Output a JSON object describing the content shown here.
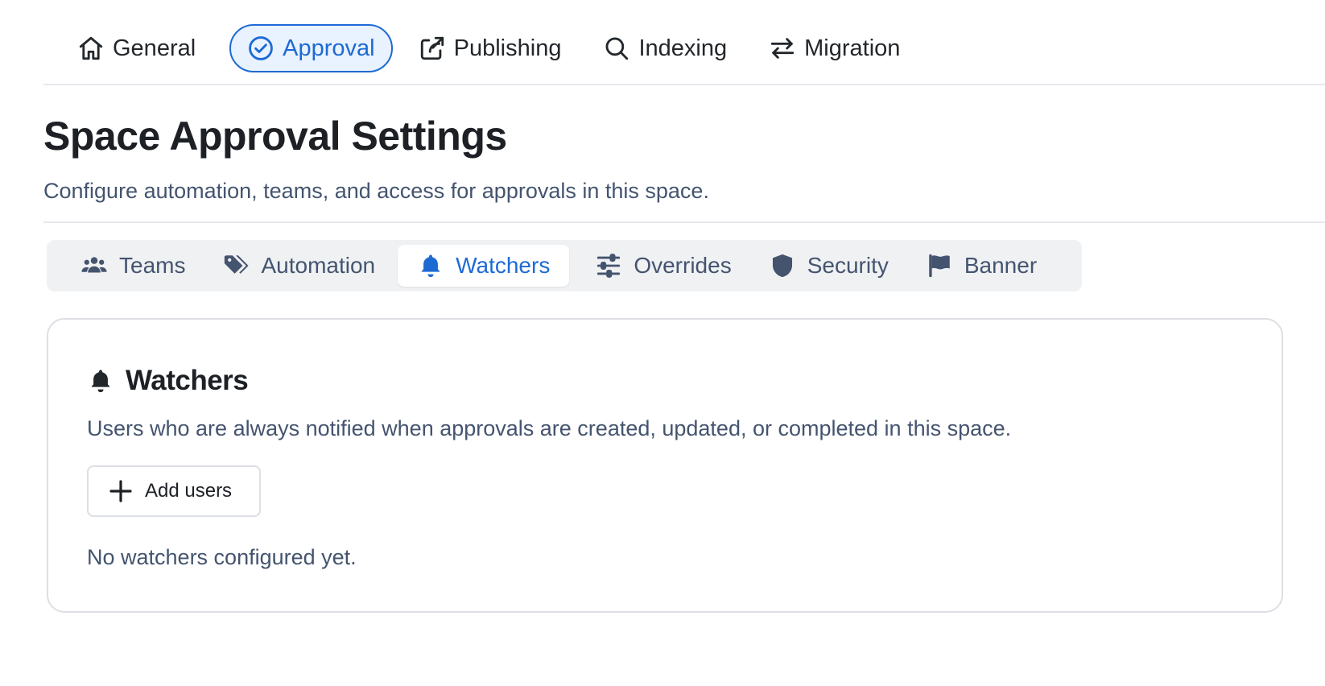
{
  "top_nav": {
    "tabs": [
      {
        "label": "General",
        "icon": "home-icon",
        "active": false
      },
      {
        "label": "Approval",
        "icon": "check-circle-icon",
        "active": true
      },
      {
        "label": "Publishing",
        "icon": "share-icon",
        "active": false
      },
      {
        "label": "Indexing",
        "icon": "search-icon",
        "active": false
      },
      {
        "label": "Migration",
        "icon": "swap-arrows-icon",
        "active": false
      }
    ]
  },
  "header": {
    "title": "Space Approval Settings",
    "subtitle": "Configure automation, teams, and access for approvals in this space."
  },
  "sub_tabs": {
    "tabs": [
      {
        "label": "Teams",
        "icon": "people-icon",
        "active": false
      },
      {
        "label": "Automation",
        "icon": "tags-icon",
        "active": false
      },
      {
        "label": "Watchers",
        "icon": "bell-icon",
        "active": true
      },
      {
        "label": "Overrides",
        "icon": "sliders-icon",
        "active": false
      },
      {
        "label": "Security",
        "icon": "shield-icon",
        "active": false
      },
      {
        "label": "Banner",
        "icon": "flag-icon",
        "active": false
      }
    ]
  },
  "watchers_card": {
    "title": "Watchers",
    "icon": "bell-icon",
    "description": "Users who are always notified when approvals are created, updated, or completed in this space.",
    "add_button_label": "Add users",
    "empty_message": "No watchers configured yet."
  },
  "colors": {
    "accent": "#1d6ad4",
    "accent_bg": "#e9f2ff",
    "text_primary": "#1d2125",
    "text_secondary": "#44546f",
    "border": "#dcdfe4",
    "tab_bar_bg": "#f0f1f3"
  }
}
